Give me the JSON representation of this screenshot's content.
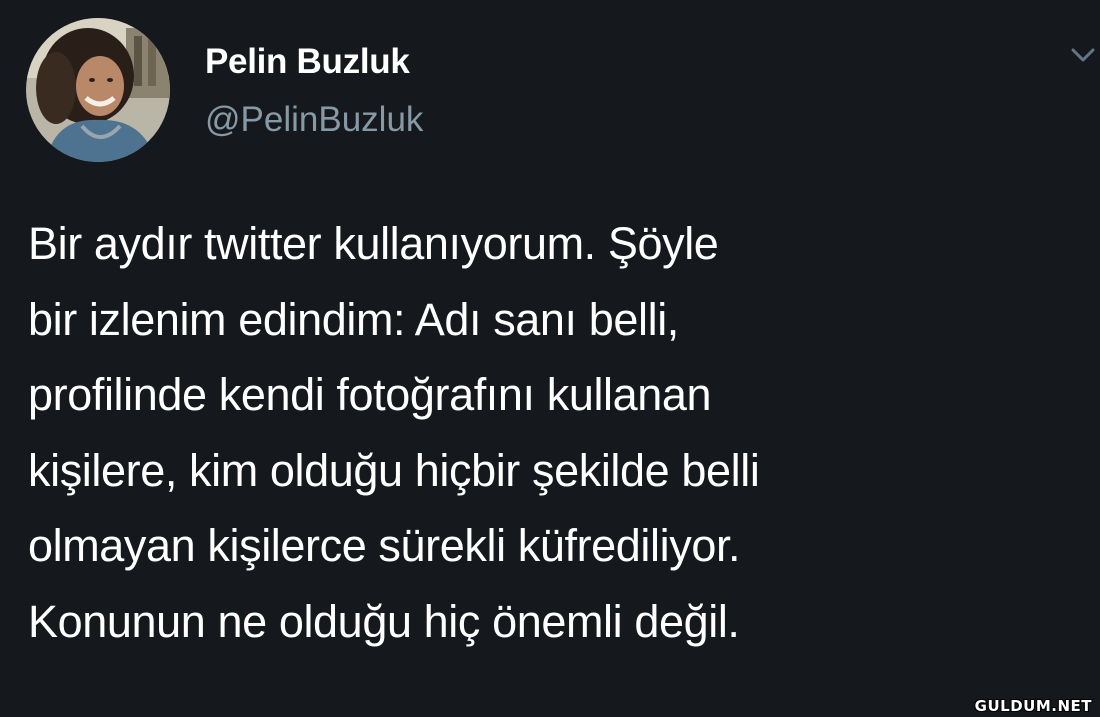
{
  "user": {
    "display_name": "Pelin Buzluk",
    "handle": "@PelinBuzluk",
    "avatar_icon": "profile-photo"
  },
  "tweet": {
    "lines": [
      "Bir aydır twitter kullanıyorum. Şöyle",
      "bir izlenim edindim: Adı sanı belli,",
      "profilinde kendi fotoğrafını kullanan",
      "kişilere, kim olduğu hiçbir şekilde belli",
      "olmayan kişilerce sürekli küfrediliyor.",
      "Konunun ne olduğu hiç önemli değil."
    ]
  },
  "menu": {
    "caret_icon": "chevron-down-icon"
  },
  "watermark": "GULDUM.NET",
  "colors": {
    "background": "#15181c",
    "text": "#ffffff",
    "secondary_text": "#8899a6"
  }
}
